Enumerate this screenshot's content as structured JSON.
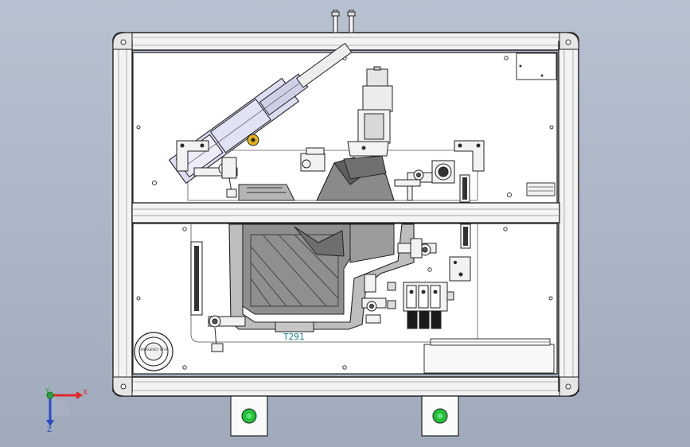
{
  "viewport": {
    "background_top": "#b7c1d0",
    "background_bottom": "#9faabb"
  },
  "model": {
    "part_number": "T291",
    "emergency_stop_label": "EMERGENCY STOP",
    "indicator_lights": [
      {
        "name": "left-indicator",
        "color": "#22c03a"
      },
      {
        "name": "right-indicator",
        "color": "#22c03a"
      }
    ]
  },
  "triad": {
    "x_label": "X",
    "y_label": "Y",
    "z_label": "Z",
    "x_color": "#e0262b",
    "y_color": "#27a33a",
    "z_color": "#2c49c8"
  }
}
